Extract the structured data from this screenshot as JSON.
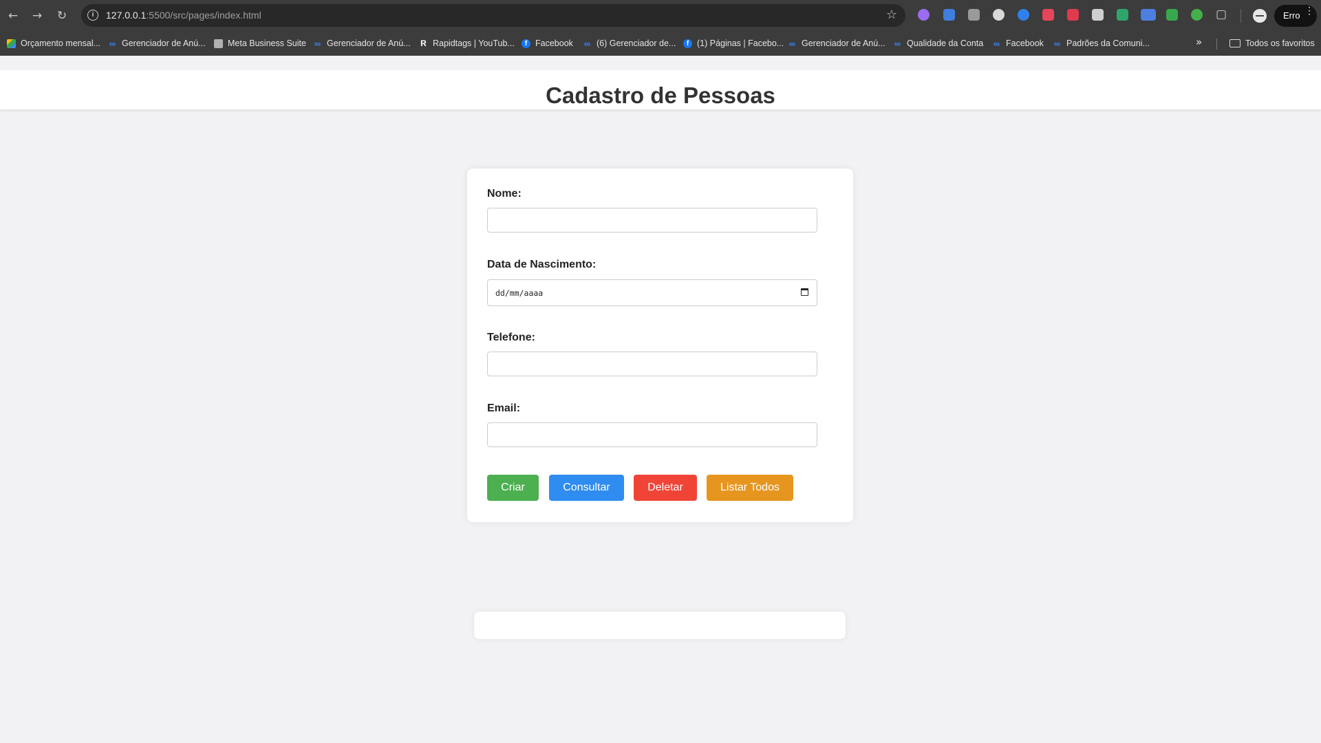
{
  "browser": {
    "url_host": "127.0.0.1",
    "url_path": ":5500/src/pages/index.html",
    "profile_label": "Erro",
    "bookmarks": [
      {
        "label": "Orçamento mensal...",
        "icon": "drive-icon"
      },
      {
        "label": "Gerenciador de Anú...",
        "icon": "meta-icon"
      },
      {
        "label": "Meta Business Suite",
        "icon": "suite-icon"
      },
      {
        "label": "Gerenciador de Anú...",
        "icon": "meta-icon"
      },
      {
        "label": "Rapidtags | YouTub...",
        "icon": "rapidtags-icon"
      },
      {
        "label": "Facebook",
        "icon": "facebook-icon"
      },
      {
        "label": "(6) Gerenciador de...",
        "icon": "meta-icon"
      },
      {
        "label": "(1) Páginas | Facebo...",
        "icon": "facebook-icon"
      },
      {
        "label": "Gerenciador de Anú...",
        "icon": "meta-icon"
      },
      {
        "label": "Qualidade da Conta",
        "icon": "meta-icon"
      },
      {
        "label": "Facebook",
        "icon": "meta-icon"
      },
      {
        "label": "Padrões da Comuni...",
        "icon": "meta-icon"
      }
    ],
    "all_bookmarks_label": "Todos os favoritos"
  },
  "page": {
    "title": "Cadastro de Pessoas"
  },
  "form": {
    "nome_label": "Nome:",
    "nome_value": "",
    "nascimento_label": "Data de Nascimento:",
    "nascimento_placeholder": "dd/mm/aaaa",
    "telefone_label": "Telefone:",
    "telefone_value": "",
    "email_label": "Email:",
    "email_value": ""
  },
  "buttons": {
    "criar": "Criar",
    "consultar": "Consultar",
    "deletar": "Deletar",
    "listar": "Listar Todos"
  },
  "colors": {
    "criar": "#4caf50",
    "consultar": "#2f8cf0",
    "deletar": "#f04437",
    "listar": "#e6951f"
  }
}
